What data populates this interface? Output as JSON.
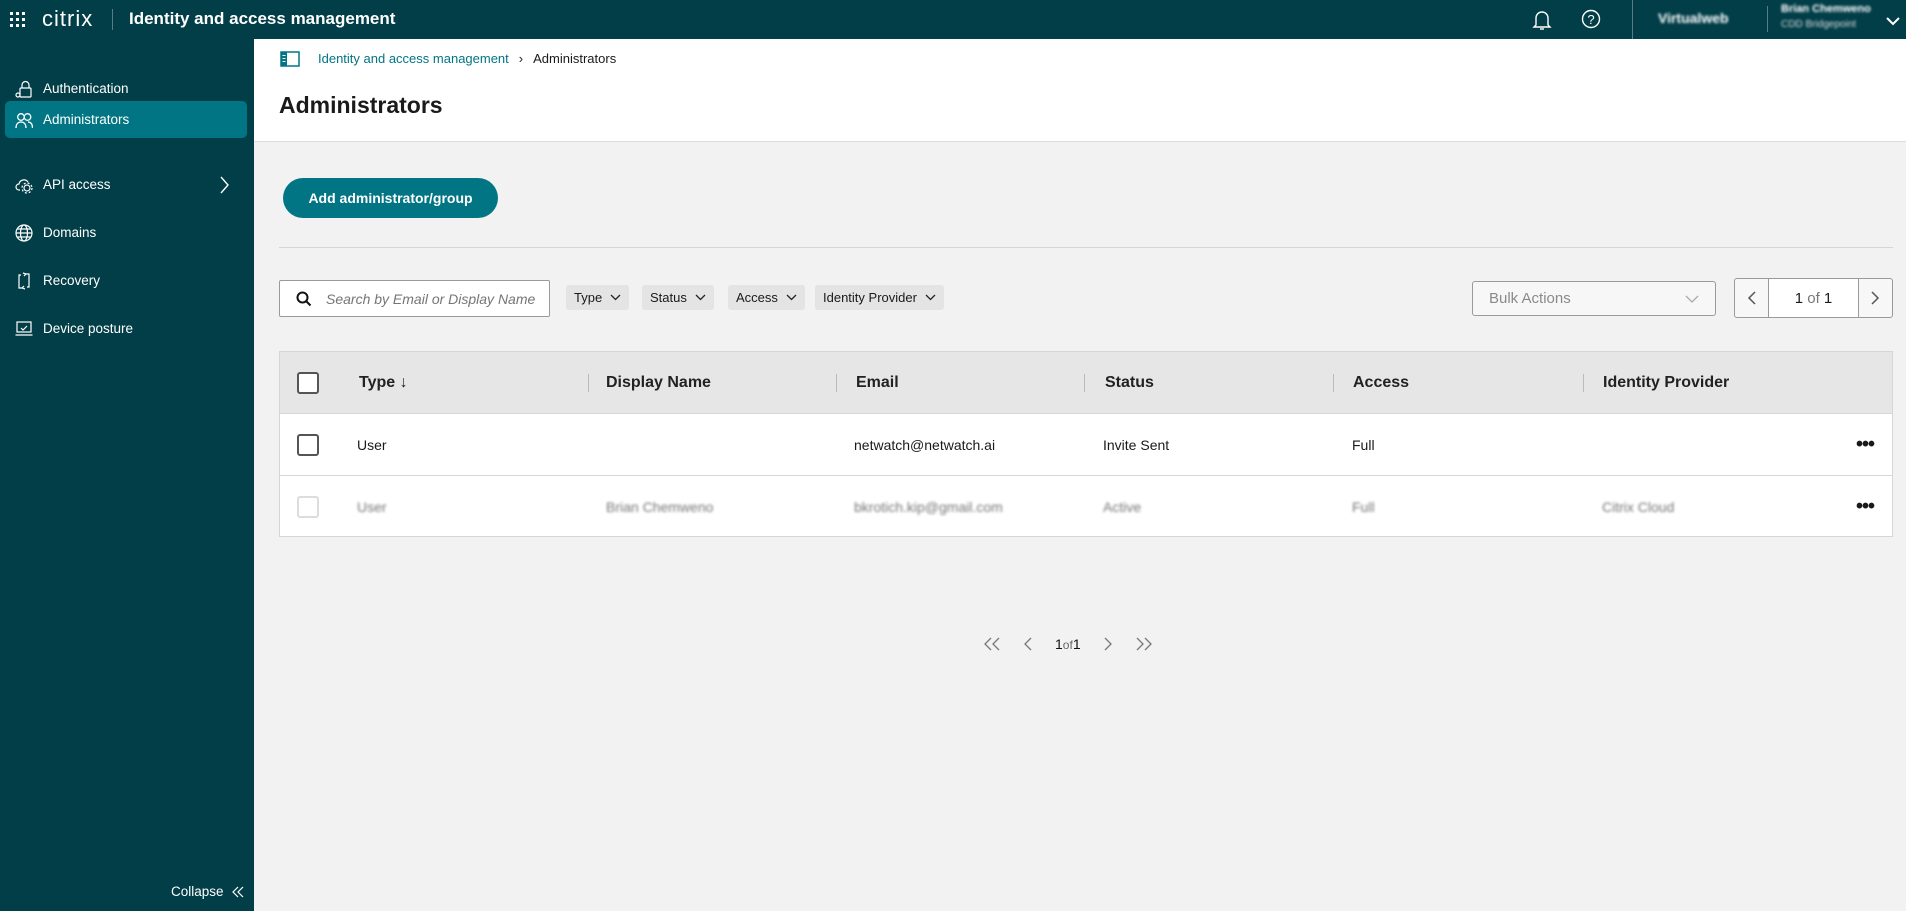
{
  "topbar": {
    "brand": "citrix",
    "title": "Identity and access management",
    "workspace": "Virtualweb",
    "user_name": "Brian Chemweno",
    "user_org": "CDD Bridgepoint"
  },
  "sidebar": {
    "items": [
      {
        "label": "Authentication",
        "icon": "lock-key-icon"
      },
      {
        "label": "Administrators",
        "icon": "users-icon",
        "active": true
      },
      {
        "label": "API access",
        "icon": "cloud-gear-icon"
      },
      {
        "label": "Domains",
        "icon": "globe-icon"
      },
      {
        "label": "Recovery",
        "icon": "recovery-icon"
      },
      {
        "label": "Device posture",
        "icon": "laptop-icon"
      }
    ],
    "collapse": "Collapse"
  },
  "breadcrumb": {
    "parent": "Identity and access management",
    "current": "Administrators"
  },
  "page": {
    "title": "Administrators",
    "add_button": "Add administrator/group"
  },
  "filters": {
    "search_placeholder": "Search by Email or Display Name",
    "chips": [
      "Type",
      "Status",
      "Access",
      "Identity Provider"
    ],
    "bulk_actions": "Bulk Actions"
  },
  "pager": {
    "current": "1",
    "of": "of",
    "total": "1"
  },
  "table": {
    "columns": [
      "Type",
      "Display Name",
      "Email",
      "Status",
      "Access",
      "Identity Provider"
    ],
    "rows": [
      {
        "type": "User",
        "display_name": "",
        "email": "netwatch@netwatch.ai",
        "status": "Invite Sent",
        "access": "Full",
        "idp": ""
      },
      {
        "type": "User",
        "display_name": "Brian Chemweno",
        "email": "bkrotich.kip@gmail.com",
        "status": "Active",
        "access": "Full",
        "idp": "Citrix Cloud"
      }
    ]
  },
  "colors": {
    "topbar": "#023e48",
    "accent": "#027584",
    "background": "#f2f2f2"
  }
}
